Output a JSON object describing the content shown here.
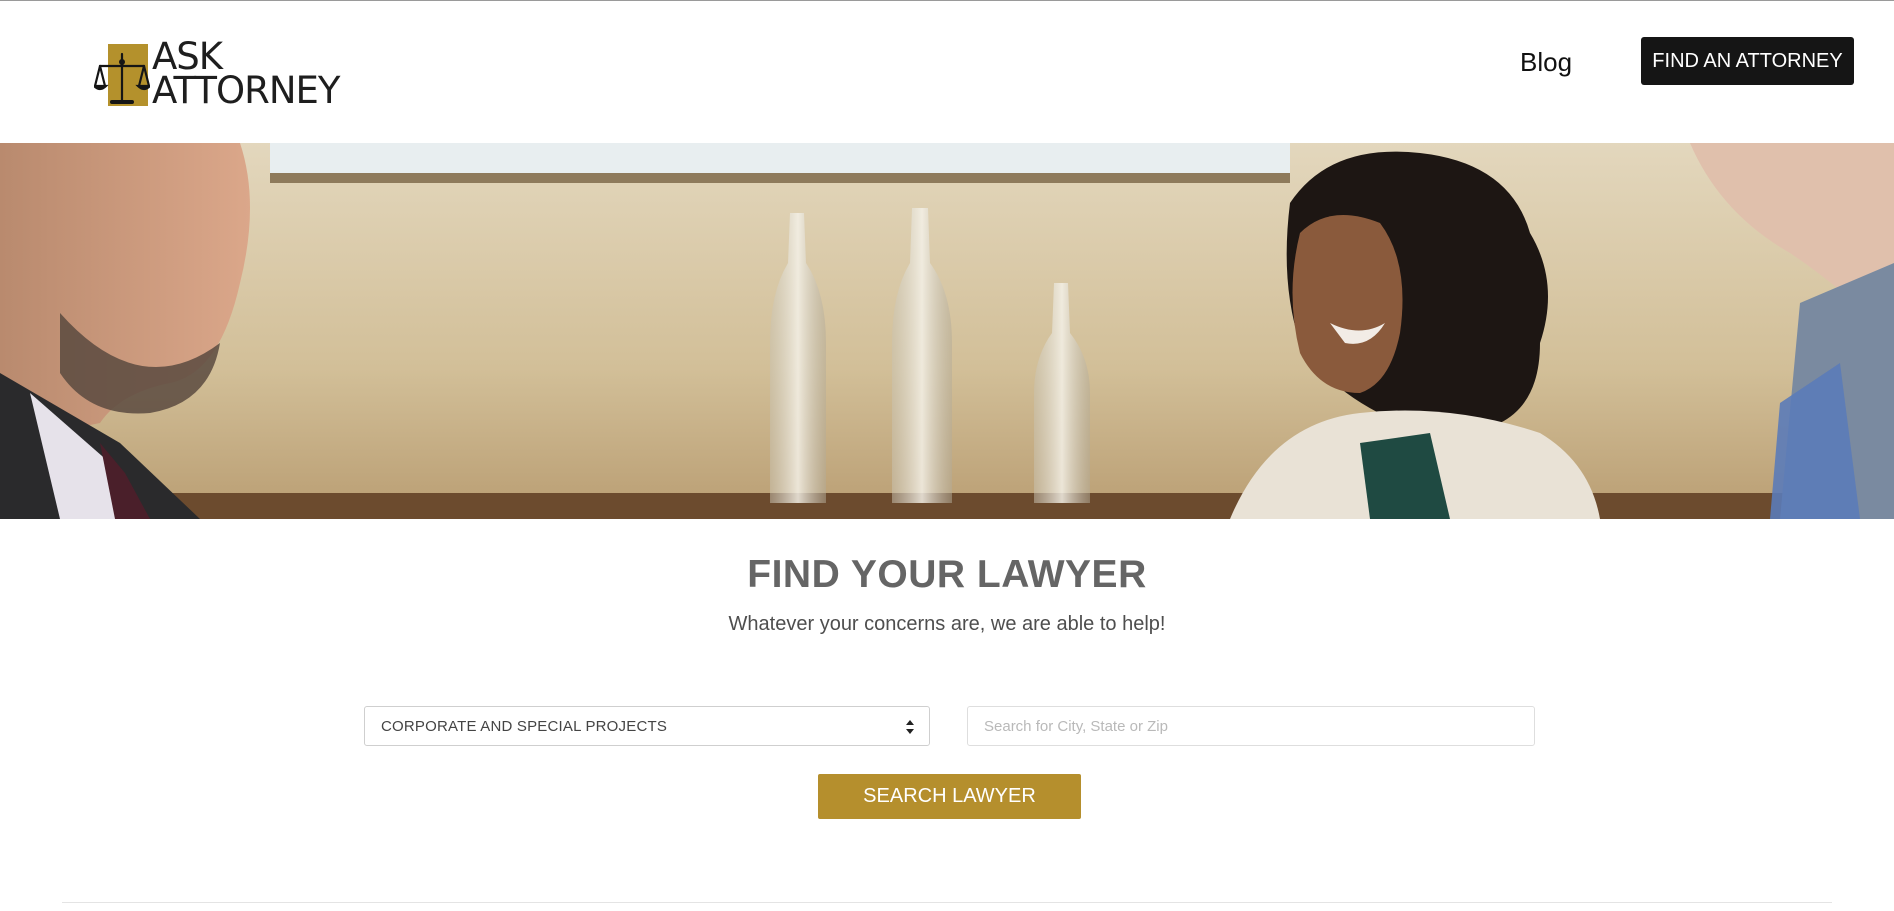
{
  "header": {
    "logo": {
      "line1": "ASK",
      "line2": "ATTORNEY"
    },
    "nav": {
      "blog_label": "Blog"
    },
    "cta_label": "FIND AN ATTORNEY"
  },
  "search": {
    "title": "FIND YOUR LAWYER",
    "subtitle": "Whatever your concerns are, we are able to help!",
    "practice_area_selected": "CORPORATE AND SPECIAL PROJECTS",
    "location_placeholder": "Search for City, State or Zip",
    "button_label": "SEARCH LAWYER"
  },
  "colors": {
    "accent_gold": "#b58f2d",
    "dark_button": "#151515",
    "title_gray": "#656565"
  },
  "icons": {
    "logo_mark": "scales-of-justice-icon",
    "select_arrows": "sort-arrows-icon"
  }
}
